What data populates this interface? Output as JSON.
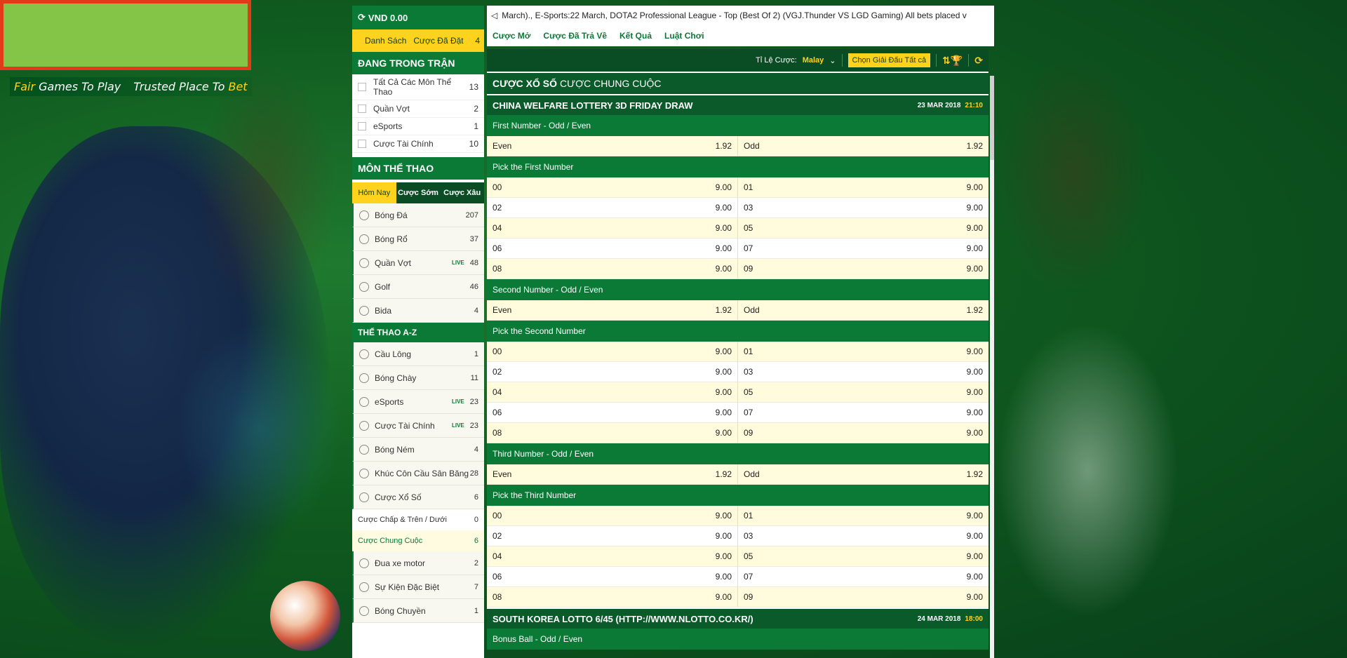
{
  "tagline": {
    "p1": "Fair",
    "p2": "Games To Play",
    "p3": "Trusted Place To",
    "p4": "Bet"
  },
  "wallet": "VND 0.00",
  "betlist": {
    "list": "Danh Sách",
    "placed": "Cược Đã Đặt",
    "count": "4"
  },
  "live": {
    "title": "Đang Trong Trận",
    "items": [
      {
        "label": "Tất Cả Các Môn Thể Thao",
        "count": "13"
      },
      {
        "label": "Quần Vợt",
        "count": "2"
      },
      {
        "label": "eSports",
        "count": "1"
      },
      {
        "label": "Cược Tài Chính",
        "count": "10"
      }
    ]
  },
  "sports_title": "Môn Thể Thao",
  "day_tabs": [
    "Hôm Nay",
    "Cược Sớm",
    "Cược Xâu"
  ],
  "sports": [
    {
      "label": "Bóng Đá",
      "count": "207",
      "live": ""
    },
    {
      "label": "Bóng Rổ",
      "count": "37",
      "live": ""
    },
    {
      "label": "Quần Vợt",
      "count": "48",
      "live": "LIVE"
    },
    {
      "label": "Golf",
      "count": "46",
      "live": ""
    },
    {
      "label": "Bida",
      "count": "4",
      "live": ""
    }
  ],
  "az_title": "THỂ THAO A-Z",
  "az": [
    {
      "label": "Cầu Lông",
      "count": "1",
      "live": ""
    },
    {
      "label": "Bóng Chày",
      "count": "11",
      "live": ""
    },
    {
      "label": "eSports",
      "count": "23",
      "live": "LIVE"
    },
    {
      "label": "Cược Tài Chính",
      "count": "23",
      "live": "LIVE"
    },
    {
      "label": "Bóng Ném",
      "count": "4",
      "live": ""
    },
    {
      "label": "Khúc Côn Cầu Sân Băng",
      "count": "28",
      "live": ""
    },
    {
      "label": "Cược Xổ Số",
      "count": "6",
      "live": ""
    }
  ],
  "lottery_sub": [
    {
      "label": "Cược Chấp & Trên / Dưới",
      "count": "0"
    },
    {
      "label": "Cược Chung Cuộc",
      "count": "6"
    }
  ],
  "az2": [
    {
      "label": "Đua xe motor",
      "count": "2"
    },
    {
      "label": "Sự Kiện Đặc Biệt",
      "count": "7"
    },
    {
      "label": "Bóng Chuyền",
      "count": "1"
    }
  ],
  "ticker": "March)., E-Sports:22 March, DOTA2 Professional League - Top (Best Of 2) (VGJ.Thunder VS LGD Gaming) All bets placed v",
  "nav": [
    "Cược Mở",
    "Cược Đã Trả Về",
    "Kết Quả",
    "Luật Chơi"
  ],
  "toolbar": {
    "odds_label": "Tỉ Lệ Cược:",
    "odds_value": "Malay",
    "filter_label": "Chọn Giải Đấu",
    "filter_value": "Tất cả"
  },
  "section": {
    "bold": "CƯỢC XỔ SỐ",
    "rest": "CƯỢC CHUNG CUỘC"
  },
  "event1": {
    "title": "CHINA WELFARE LOTTERY 3D FRIDAY DRAW",
    "date": "23 MAR 2018",
    "time": "21:10"
  },
  "markets": [
    {
      "title": "First Number - Odd / Even",
      "rows": [
        [
          [
            "Even",
            "1.92"
          ],
          [
            "Odd",
            "1.92"
          ]
        ]
      ]
    },
    {
      "title": "Pick the First Number",
      "rows": [
        [
          [
            "00",
            "9.00"
          ],
          [
            "01",
            "9.00"
          ]
        ],
        [
          [
            "02",
            "9.00"
          ],
          [
            "03",
            "9.00"
          ]
        ],
        [
          [
            "04",
            "9.00"
          ],
          [
            "05",
            "9.00"
          ]
        ],
        [
          [
            "06",
            "9.00"
          ],
          [
            "07",
            "9.00"
          ]
        ],
        [
          [
            "08",
            "9.00"
          ],
          [
            "09",
            "9.00"
          ]
        ]
      ]
    },
    {
      "title": "Second Number - Odd / Even",
      "rows": [
        [
          [
            "Even",
            "1.92"
          ],
          [
            "Odd",
            "1.92"
          ]
        ]
      ]
    },
    {
      "title": "Pick the Second Number",
      "rows": [
        [
          [
            "00",
            "9.00"
          ],
          [
            "01",
            "9.00"
          ]
        ],
        [
          [
            "02",
            "9.00"
          ],
          [
            "03",
            "9.00"
          ]
        ],
        [
          [
            "04",
            "9.00"
          ],
          [
            "05",
            "9.00"
          ]
        ],
        [
          [
            "06",
            "9.00"
          ],
          [
            "07",
            "9.00"
          ]
        ],
        [
          [
            "08",
            "9.00"
          ],
          [
            "09",
            "9.00"
          ]
        ]
      ]
    },
    {
      "title": "Third Number - Odd / Even",
      "rows": [
        [
          [
            "Even",
            "1.92"
          ],
          [
            "Odd",
            "1.92"
          ]
        ]
      ]
    },
    {
      "title": "Pick the Third Number",
      "rows": [
        [
          [
            "00",
            "9.00"
          ],
          [
            "01",
            "9.00"
          ]
        ],
        [
          [
            "02",
            "9.00"
          ],
          [
            "03",
            "9.00"
          ]
        ],
        [
          [
            "04",
            "9.00"
          ],
          [
            "05",
            "9.00"
          ]
        ],
        [
          [
            "06",
            "9.00"
          ],
          [
            "07",
            "9.00"
          ]
        ],
        [
          [
            "08",
            "9.00"
          ],
          [
            "09",
            "9.00"
          ]
        ]
      ]
    }
  ],
  "event2": {
    "title": "SOUTH KOREA LOTTO 6/45 (HTTP://WWW.NLOTTO.CO.KR/)",
    "date": "24 MAR 2018",
    "time": "18:00"
  },
  "market2": "Bonus Ball - Odd / Even",
  "colors": {
    "primary": "#0b7a36",
    "dark": "#0a4d24",
    "accent": "#ffd21e"
  }
}
